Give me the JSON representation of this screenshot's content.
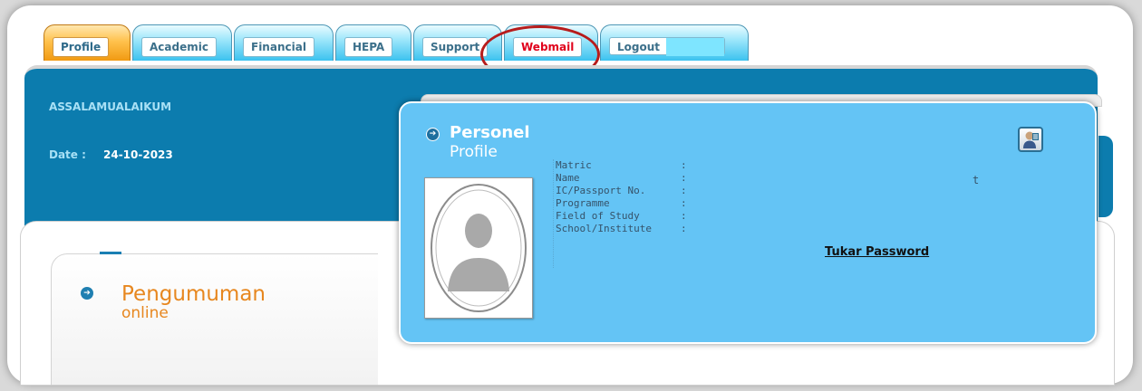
{
  "tabs": [
    {
      "label": "Profile",
      "active": true
    },
    {
      "label": "Academic"
    },
    {
      "label": "Financial"
    },
    {
      "label": "HEPA"
    },
    {
      "label": "Support"
    },
    {
      "label": "Webmail",
      "highlighted": true
    },
    {
      "label": "Logout"
    }
  ],
  "header": {
    "greeting": "ASSALAMUALAIKUM",
    "date_label": "Date :",
    "date_value": "24-10-2023"
  },
  "announcement": {
    "title": "Pengumuman",
    "subtitle": "online"
  },
  "profile_card": {
    "title": "Personel",
    "subtitle": "Profile",
    "fields": [
      {
        "label": "Matric",
        "value": ""
      },
      {
        "label": "Name",
        "value": "t"
      },
      {
        "label": "IC/Passport No.",
        "value": ""
      },
      {
        "label": "Programme",
        "value": ""
      },
      {
        "label": "Field of Study",
        "value": ""
      },
      {
        "label": "School/Institute",
        "value": ""
      }
    ],
    "colon": ":",
    "change_password_link": "Tukar Password",
    "user_icon": "user-profile-icon",
    "photo_icon": "avatar-placeholder-icon"
  },
  "colors": {
    "header_blue": "#0c7cae",
    "card_blue": "#64c4f5",
    "accent_orange": "#e7871f",
    "highlight_red": "#b71c1c",
    "webmail_red": "#e0001b"
  }
}
